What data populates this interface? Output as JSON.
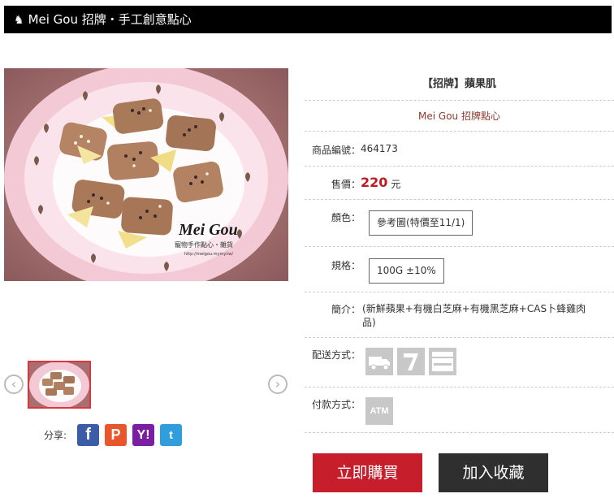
{
  "header": {
    "icon": "chess-knight-icon",
    "title": "Mei Gou 招牌・手工創意點心"
  },
  "product": {
    "name": "【招牌】蘋果肌",
    "brand": "Mei Gou 招牌點心",
    "code_label": "商品編號：",
    "code": "464173",
    "price_label": "售價：",
    "price": "220",
    "price_unit": "元",
    "color_label": "顏色：",
    "color_value": "參考圖(特價至11/1)",
    "spec_label": "規格：",
    "spec_value": "100G ±10%",
    "desc_label": "簡介：",
    "description": "(新鮮蘋果+有機白芝麻+有機黑芝麻+CAS卜蜂雞肉品)",
    "shipping_label": "配送方式：",
    "shipping_icons": [
      "delivery-truck-icon",
      "seven-eleven-icon",
      "familymart-icon"
    ],
    "payment_label": "付款方式：",
    "payment_icon_text": "ATM"
  },
  "photo": {
    "logo_text": "Mei Gou",
    "logo_sub": "寵物手作點心・雜貨",
    "logo_url": "http://meigou.mymy.tw/"
  },
  "gallery": {
    "prev_symbol": "‹",
    "next_symbol": "›"
  },
  "share": {
    "label": "分享:",
    "facebook": "f",
    "plurk": "P",
    "yahoo": "Y!",
    "twitter": "t"
  },
  "actions": {
    "buy_label": "立即購買",
    "favorite_label": "加入收藏"
  },
  "colors": {
    "header_bg": "#000000",
    "price": "#c01920",
    "buy": "#c61f2b",
    "favorite": "#2f2f2f",
    "thumb_border": "#d9373d"
  }
}
